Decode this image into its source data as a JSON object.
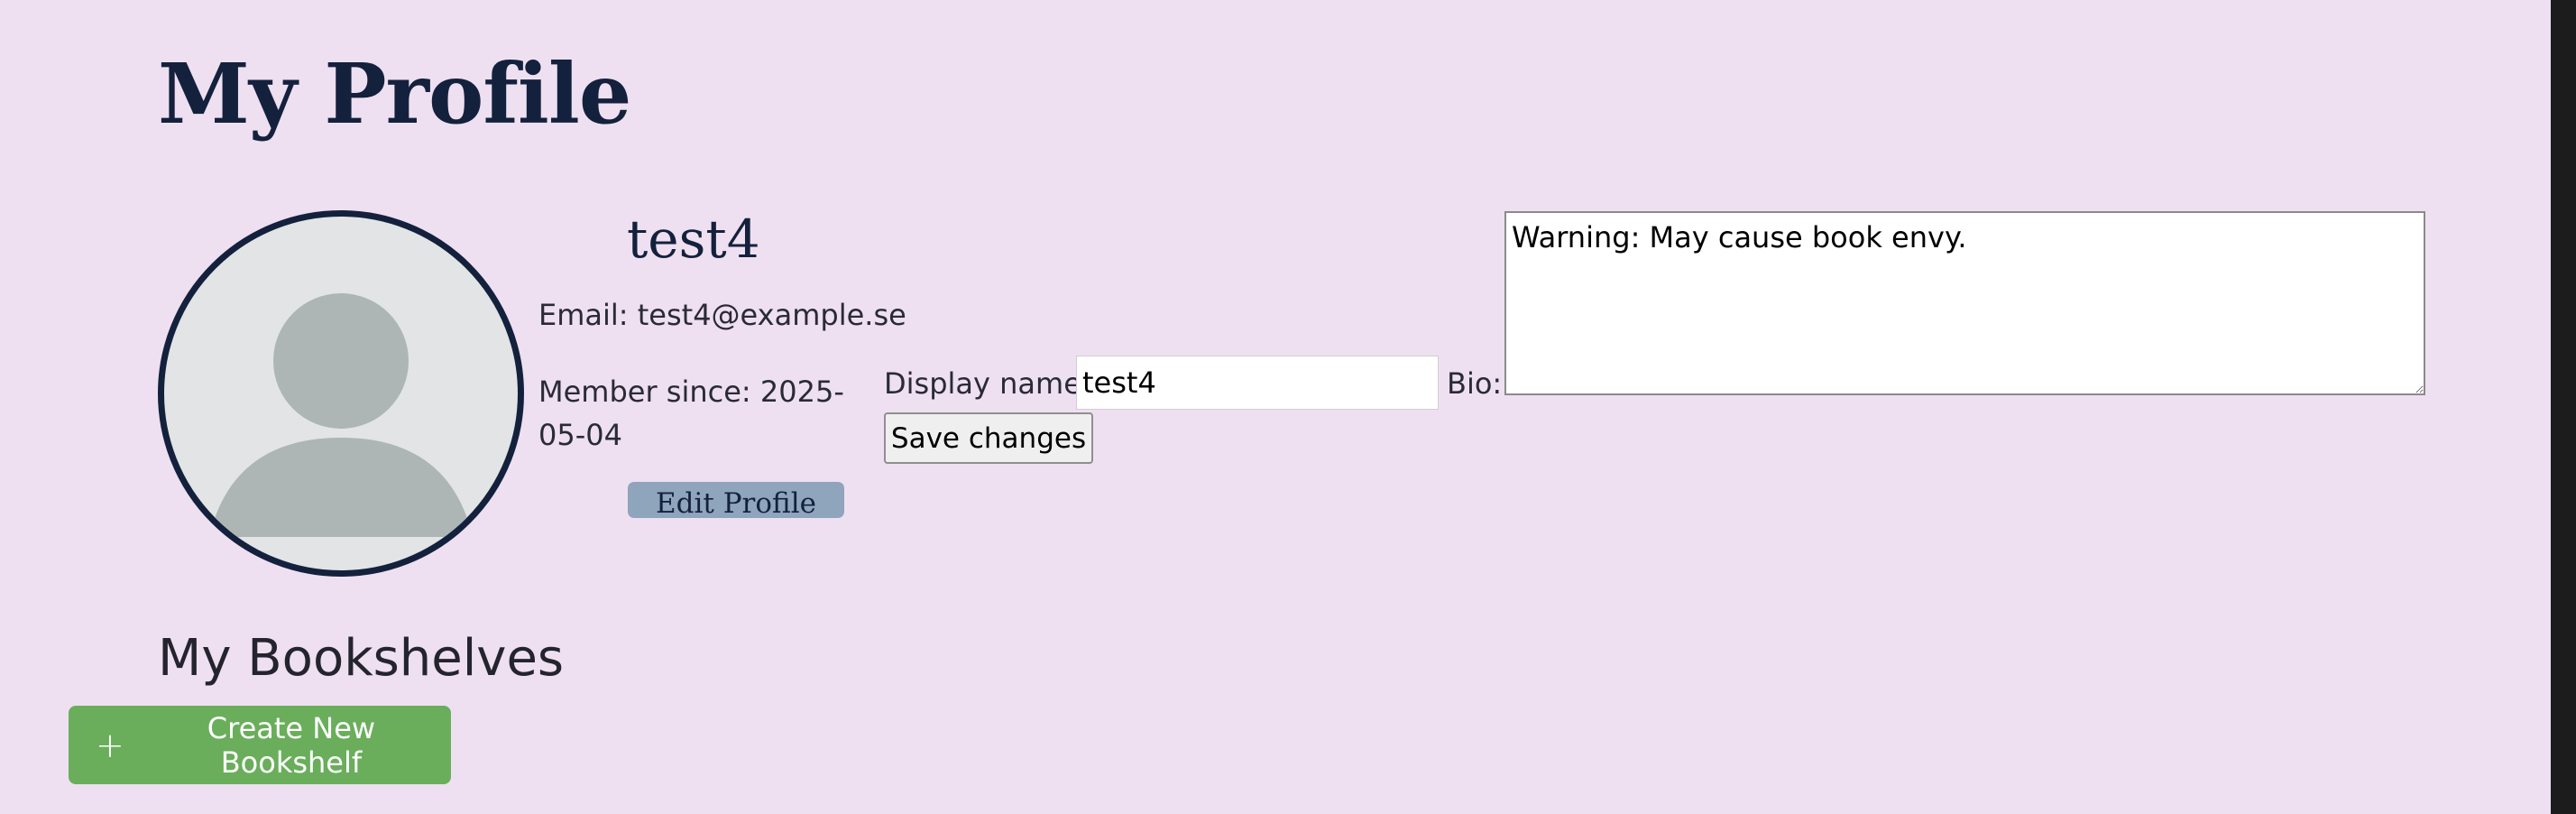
{
  "page": {
    "title": "My Profile",
    "background_color": "#eee0f1"
  },
  "profile": {
    "username": "test4",
    "email_text": "Email: test4@example.se",
    "member_since_text": "Member since: 2025-05-04",
    "edit_button_label": "Edit Profile",
    "avatar_icon": "default-user-avatar-icon"
  },
  "edit_form": {
    "display_name_label": "Display name:",
    "display_name_value": "test4",
    "bio_label": "Bio:",
    "bio_value": "Warning: May cause book envy.",
    "save_button_label": "Save changes"
  },
  "bookshelves": {
    "heading": "My Bookshelves",
    "create_button_label": "Create New Bookshelf",
    "create_button_icon": "plus-icon",
    "create_button_color": "#6aae5c"
  },
  "colors": {
    "title": "#14213d",
    "avatar_border": "#14213d",
    "edit_button": "#8ea5bc"
  }
}
